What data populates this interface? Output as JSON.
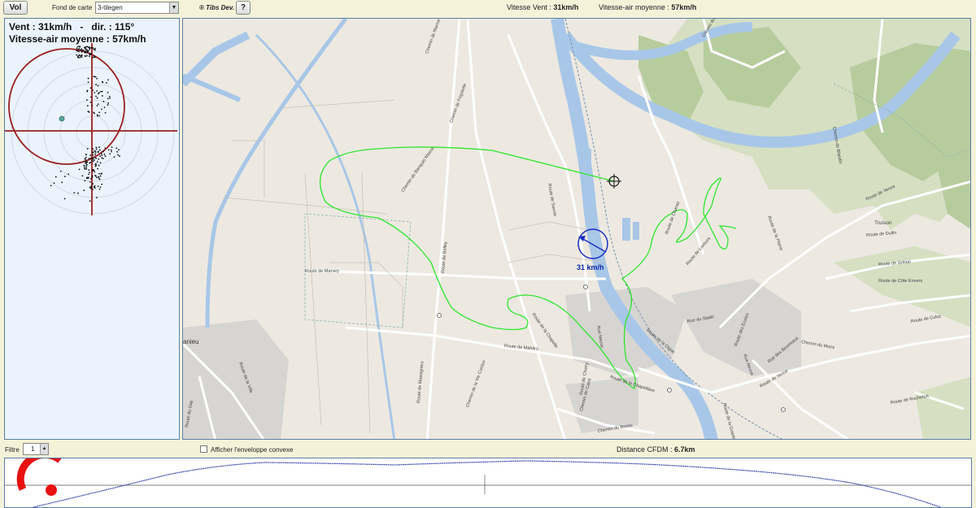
{
  "toolbar": {
    "vol_label": "Vol",
    "fond_label": "Fond de carte",
    "fond_value": "3-tilegen",
    "tibs_label": "® Tibs Dev.",
    "help_label": "?",
    "vent_label": "Vitesse Vent :",
    "vent_value": "31km/h",
    "air_label": "Vitesse-air moyenne :",
    "air_value": "57km/h"
  },
  "left_panel": {
    "line1": "Vent : 31km/h   -   dir. : 115°",
    "line2": "Vitesse-air moyenne : 57km/h"
  },
  "map": {
    "wind_arrow_label": "31 km/h",
    "labels": [
      {
        "text": "Chemin de Marine",
        "cls": "l1"
      },
      {
        "text": "Chemin de Banquet Masse",
        "cls": "l2"
      },
      {
        "text": "Route de Belley",
        "cls": "l3"
      },
      {
        "text": "Route de Marvey",
        "cls": "l4"
      },
      {
        "text": "Route de Mahieu",
        "cls": "l5"
      },
      {
        "text": "Route de la Chapelle",
        "cls": "l6"
      },
      {
        "text": "Route de la Chapellière",
        "cls": "l7"
      },
      {
        "text": "Route de Chorry",
        "cls": "l8"
      },
      {
        "text": "Route de Savoie",
        "cls": "l9"
      },
      {
        "text": "Rue Neuve",
        "cls": "l10"
      },
      {
        "text": "Route de Chanaz",
        "cls": "l11"
      },
      {
        "text": "Rue du Stade",
        "cls": "l12"
      },
      {
        "text": "Route de Lavours",
        "cls": "l13"
      },
      {
        "text": "Route de la Digue",
        "cls": "l14"
      },
      {
        "text": "Route de Rochefort",
        "cls": "l15"
      },
      {
        "text": "Truison",
        "cls": "l16"
      },
      {
        "text": "Route de Dullin",
        "cls": "l17"
      },
      {
        "text": "Route de Grésin",
        "cls": "l18"
      },
      {
        "text": "Route de Côte Envers",
        "cls": "l19"
      },
      {
        "text": "Route de Yenne",
        "cls": "l20"
      },
      {
        "text": "Route de la Plaine",
        "cls": "l21"
      },
      {
        "text": "Chemin du Moirs",
        "cls": "l22"
      },
      {
        "text": "Route de la Golette",
        "cls": "l23"
      },
      {
        "text": "Chemin du Vieux Port",
        "cls": "l24"
      },
      {
        "text": "Chemin de Blandin",
        "cls": "l25"
      },
      {
        "text": "Route de la Ville",
        "cls": "l26"
      },
      {
        "text": "Chemin de la Vie Cordon",
        "cls": "l27"
      },
      {
        "text": "Chemin du Bossu",
        "cls": "l28"
      },
      {
        "text": "Chemin de Frigolette",
        "cls": "l29"
      },
      {
        "text": "Route de Massignieu",
        "cls": "l30"
      },
      {
        "text": "Chemin de Carré",
        "cls": "l31"
      },
      {
        "text": "anieu",
        "cls": "l32"
      },
      {
        "text": "Route du Gay",
        "cls": "l33"
      },
      {
        "text": "Route des Ecoles",
        "cls": "l34"
      },
      {
        "text": "Rue Neuve",
        "cls": "l35"
      },
      {
        "text": "Route de Culoz",
        "cls": "l36"
      },
      {
        "text": "Rue des Bourreaux",
        "cls": "l37"
      },
      {
        "text": "Route de Yenne",
        "cls": "l38"
      }
    ]
  },
  "bottombar": {
    "filtre_label": "Filtre",
    "filtre_value": "1",
    "env_label": "Afficher l'enveloppe convexe",
    "dist_label": "Distance CFDM :",
    "dist_value": "6.7km"
  },
  "colors": {
    "track": "#2ee62e",
    "wind": "#1a2fc0",
    "polar_circle": "#9a2020",
    "profile_line": "#1a2fa0",
    "indicator": "#e81010"
  },
  "icons": {
    "position_marker": "crosshair-circle-icon",
    "wind_arrow": "wind-arrow-icon",
    "loader": "red-arc-loader-icon"
  }
}
